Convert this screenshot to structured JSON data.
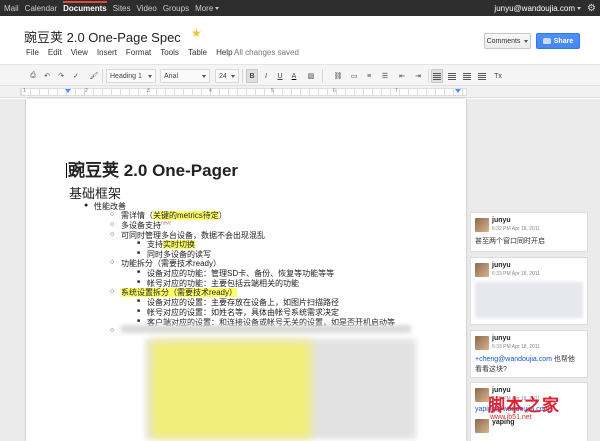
{
  "gbar": {
    "nav": [
      "Mail",
      "Calendar",
      "Documents",
      "Sites",
      "Video",
      "Groups",
      "More"
    ],
    "active": "Documents",
    "account": "junyu@wandoujia.com"
  },
  "doc": {
    "title": "豌豆荚 2.0 One-Page Spec",
    "menu": [
      "File",
      "Edit",
      "View",
      "Insert",
      "Format",
      "Tools",
      "Table",
      "Help"
    ],
    "status": "All changes saved",
    "comments_label": "Comments",
    "share_label": "Share"
  },
  "toolbar": {
    "style": "Heading 1",
    "font": "Arial",
    "size": "24",
    "bold": "B",
    "italic": "I",
    "underline": "U",
    "textcolor": "A"
  },
  "ruler": {
    "numbers": [
      "1",
      "2",
      "3",
      "4",
      "5",
      "6",
      "7"
    ]
  },
  "body": {
    "title": "豌豆荚 2.0 One-Pager",
    "h2": "基础框架",
    "l1": "性能改善",
    "l2a": "需详情（",
    "l2a_hl": "关键的metrics待定",
    "l2a_end": "）",
    "l2b": "多设备支持",
    "l2b_new": "new!",
    "l2c": "可同时管理多台设备，数据不会出现混乱",
    "l3a": "支持",
    "l3a_hl": "实时切换",
    "l3b": "同时多设备的读写",
    "l2d": "功能拆分（需要技术ready）",
    "l3c": "设备对应的功能：管理SD卡、备份、恢复等功能等等",
    "l3d": "帐号对应的功能：主要包括云端相关的功能",
    "l2e": "系统设置拆分（需要技术ready）",
    "l3e": "设备对应的设置：主要存放在设备上，如图片扫描路径",
    "l3f": "帐号对应的设置：如姓名等，具体由帐号系统需求决定",
    "l3g": "客户端对应的设置：和连接设备或帐号无关的设置，如是否开机启动等"
  },
  "comments": [
    {
      "author": "junyu",
      "time": "6:32 PM Apr 18, 2011",
      "text": "甚至两个窗口同时开启"
    },
    {
      "author": "junyu",
      "time": "6:33 PM Apr 18, 2011"
    },
    {
      "author": "junyu",
      "time": "6:33 PM Apr 18, 2011",
      "link": "+cheng@wandoujia.com",
      "text_after": "也帮他",
      "text2": "看看这块?"
    },
    {
      "author": "junyu",
      "author2": "yaping",
      "time": "6:33 PM Apr 18, 2011",
      "mention": "yaping@wandoujia.com"
    }
  ],
  "watermark": {
    "text": "脚本之家",
    "url": "www.jb51.net"
  }
}
